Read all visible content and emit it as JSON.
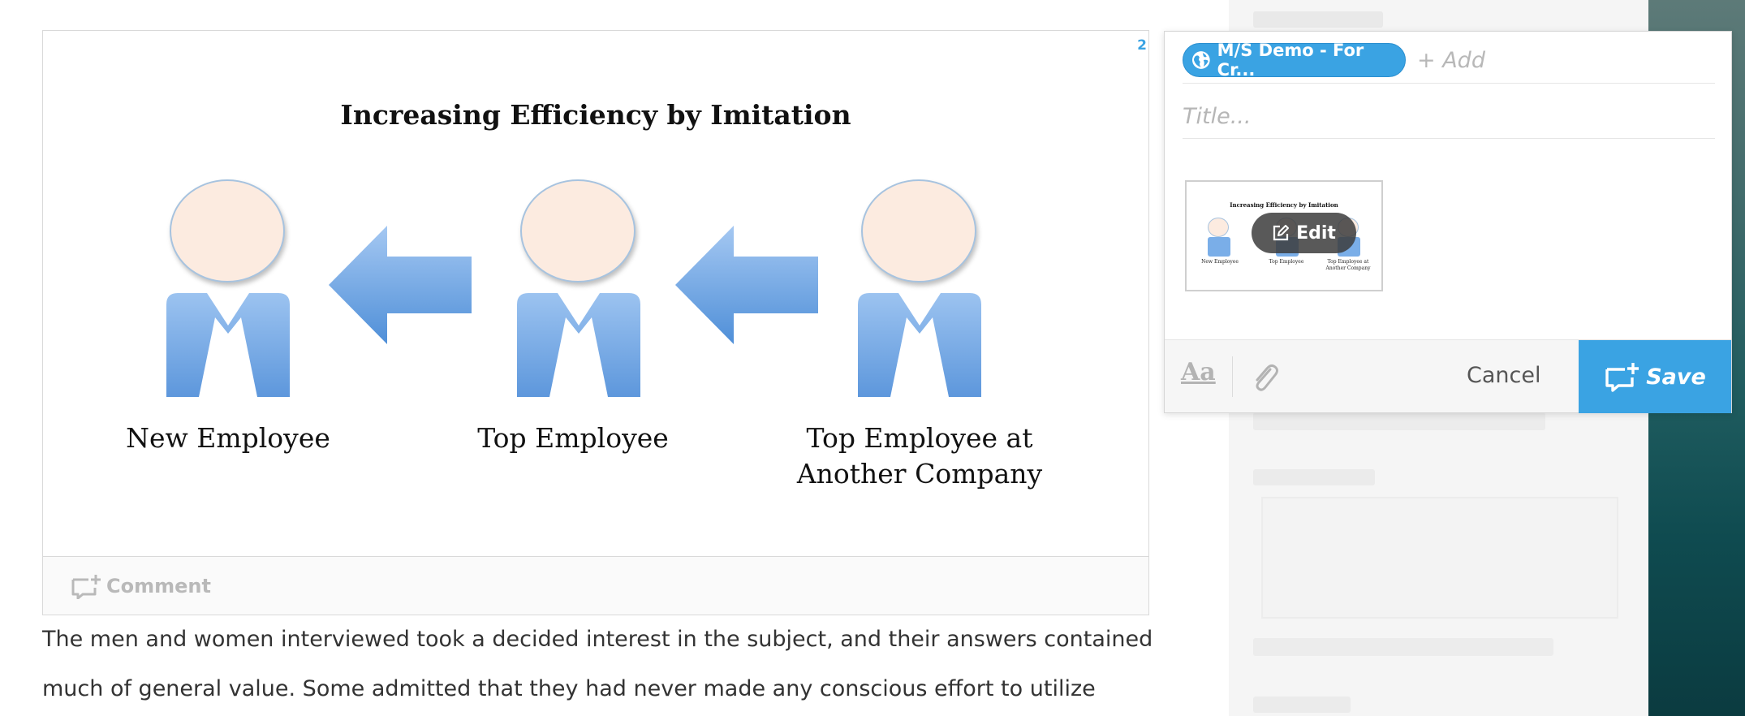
{
  "slide": {
    "page_number": "2",
    "title": "Increasing Efficiency by Imitation",
    "labels": {
      "new_employee": "New Employee",
      "top_employee": "Top Employee",
      "top_employee_other_line1": "Top Employee at",
      "top_employee_other_line2": "Another Company"
    }
  },
  "comment_bar": {
    "label": "Comment"
  },
  "article": {
    "line1": "The men and women interviewed took a decided interest in the subject, and their answers contained",
    "line2": "much of general value. Some admitted that they had never made any conscious effort to utilize"
  },
  "composer": {
    "tag_label": "M/S Demo - For Cr...",
    "add_label": "+ Add",
    "title_placeholder": "Title...",
    "title_value": "",
    "thumbnail": {
      "title": "Increasing Efficiency by Imitation",
      "labels": [
        "New Employee",
        "Top Employee",
        "Top Employee at Another Company"
      ],
      "edit_label": "Edit"
    },
    "format_label": "Aa",
    "cancel_label": "Cancel",
    "save_label": "Save"
  },
  "colors": {
    "accent": "#3aa3e3",
    "person_blue": "#6fa7e6",
    "head_fill": "#fcebe0"
  },
  "icons": [
    "globe-icon",
    "edit-icon",
    "paperclip-icon",
    "comment-add-icon"
  ]
}
